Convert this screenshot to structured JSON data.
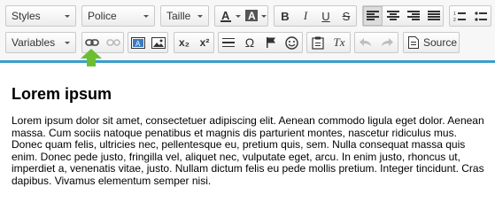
{
  "toolbar": {
    "styles_combo": "Styles",
    "font_combo": "Police",
    "size_combo": "Taille",
    "variables_combo": "Variables",
    "bold": "B",
    "italic": "I",
    "underline": "U",
    "strike": "S",
    "subscript": "x₂",
    "superscript": "x²",
    "special_char": "Ω",
    "source_label": "Source",
    "remove_format": "Tx"
  },
  "editor": {
    "heading": "Lorem ipsum",
    "paragraph": "Lorem ipsum dolor sit amet, consectetuer adipiscing elit. Aenean commodo ligula eget dolor. Aenean massa. Cum sociis natoque penatibus et magnis dis parturient montes, nascetur ridiculus mus. Donec quam felis, ultricies nec, pellentesque eu, pretium quis, sem. Nulla consequat massa quis enim. Donec pede justo, fringilla vel, aliquet nec, vulputate eget, arcu. In enim justo, rhoncus ut, imperdiet a, venenatis vitae, justo. Nullam dictum felis eu pede mollis pretium. Integer tincidunt. Cras dapibus. Vivamus elementum semper nisi."
  },
  "colors": {
    "accent_bar": "#3b9ec9",
    "pointer_arrow": "#6abf2f"
  }
}
